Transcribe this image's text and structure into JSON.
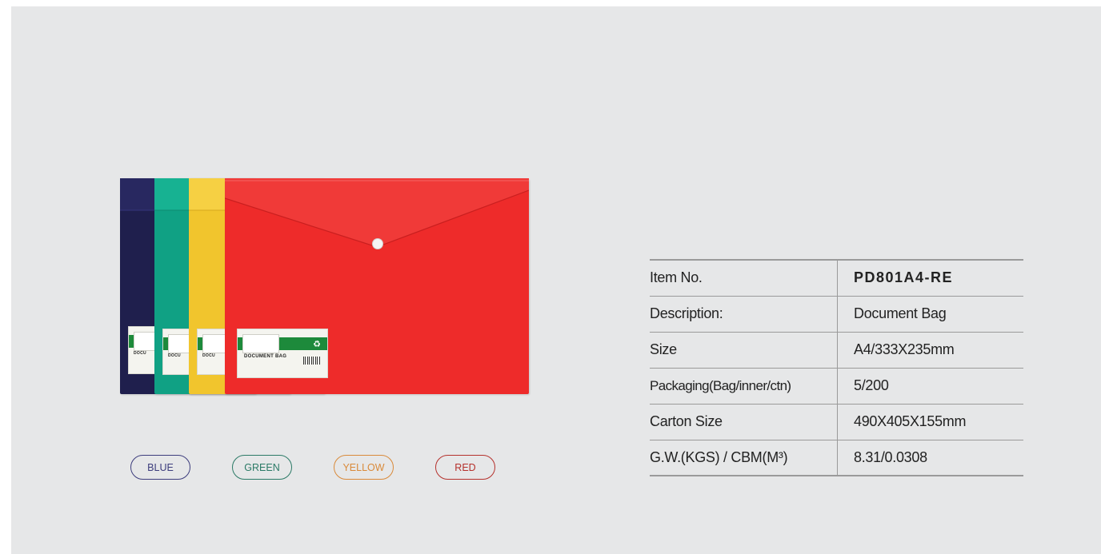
{
  "product_image": {
    "label_text": "DOCUMENT BAG",
    "label_text_partial": "DOCU",
    "folder_colors": [
      "#1f1f4d",
      "#10a184",
      "#f1c52d",
      "#ee2b2a"
    ]
  },
  "color_options": [
    {
      "label": "BLUE",
      "color": "#3d3d7d"
    },
    {
      "label": "GREEN",
      "color": "#2b7a66"
    },
    {
      "label": "YELLOW",
      "color": "#d98a3a"
    },
    {
      "label": "RED",
      "color": "#b5312c"
    }
  ],
  "spec_table": [
    {
      "key": "Item No.",
      "value": "PD801A4-RE"
    },
    {
      "key": "Description:",
      "value": "Document Bag"
    },
    {
      "key": "Size",
      "value": "A4/333X235mm"
    },
    {
      "key": "Packaging(Bag/inner/ctn)",
      "value": "5/200"
    },
    {
      "key": "Carton Size",
      "value": "490X405X155mm"
    },
    {
      "key": "G.W.(KGS) / CBM(M³)",
      "value": "8.31/0.0308"
    }
  ]
}
